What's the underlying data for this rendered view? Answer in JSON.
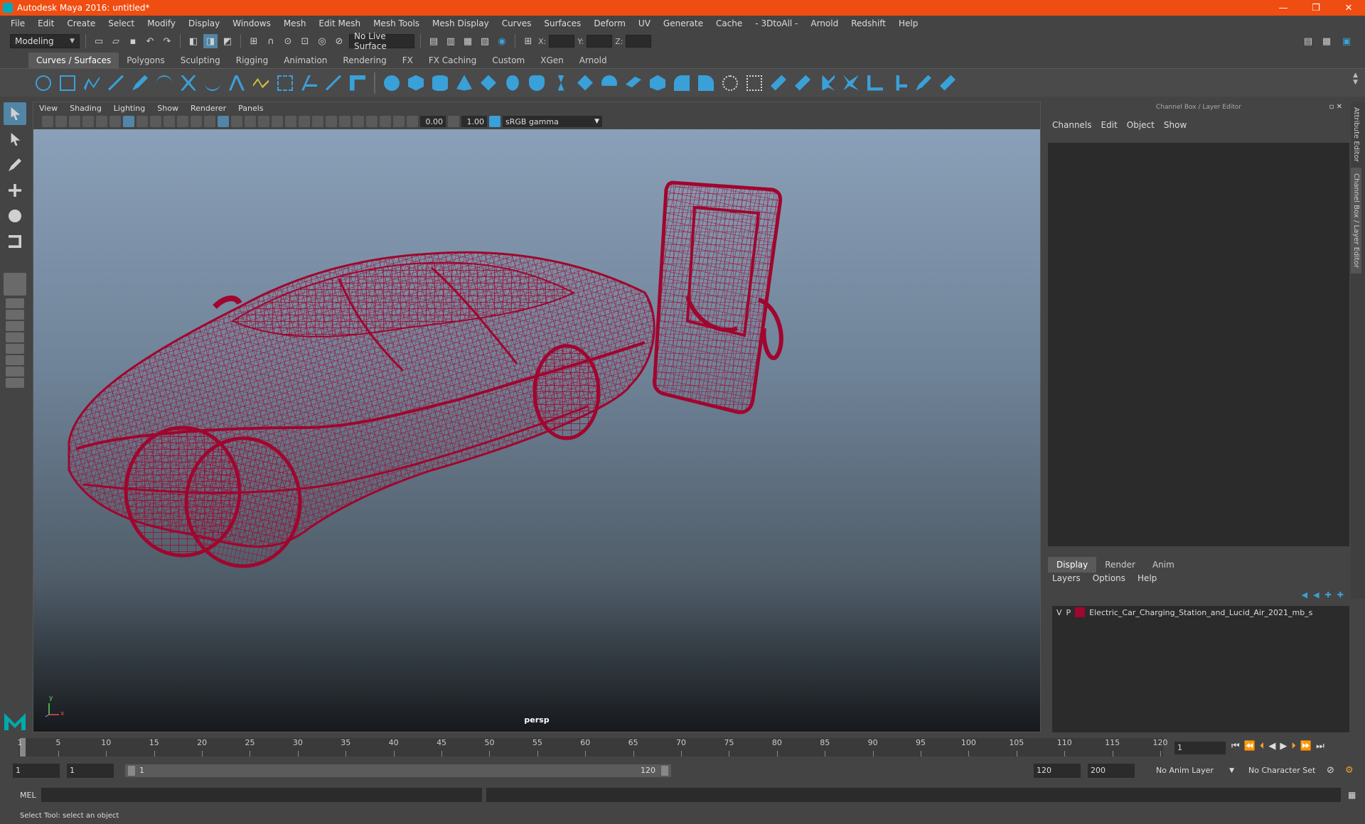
{
  "window": {
    "title": "Autodesk Maya 2016: untitled*",
    "min": "—",
    "max": "❐",
    "close": "✕"
  },
  "menubar": [
    "File",
    "Edit",
    "Create",
    "Select",
    "Modify",
    "Display",
    "Windows",
    "Mesh",
    "Edit Mesh",
    "Mesh Tools",
    "Mesh Display",
    "Curves",
    "Surfaces",
    "Deform",
    "UV",
    "Generate",
    "Cache",
    "- 3DtoAll -",
    "Arnold",
    "Redshift",
    "Help"
  ],
  "statusline": {
    "mode": "Modeling",
    "live_surface": "No Live Surface",
    "x_label": "X:",
    "y_label": "Y:",
    "z_label": "Z:"
  },
  "shelf_tabs": [
    "Curves / Surfaces",
    "Polygons",
    "Sculpting",
    "Rigging",
    "Animation",
    "Rendering",
    "FX",
    "FX Caching",
    "Custom",
    "XGen",
    "Arnold"
  ],
  "panel": {
    "menu": [
      "View",
      "Shading",
      "Lighting",
      "Show",
      "Renderer",
      "Panels"
    ],
    "exposure": "0.00",
    "gamma": "1.00",
    "colorspace": "sRGB gamma",
    "camera": "persp",
    "axis_y": "y",
    "axis_x": "x"
  },
  "channel_box": {
    "header": "Channel Box / Layer Editor",
    "menu": [
      "Channels",
      "Edit",
      "Object",
      "Show"
    ]
  },
  "layer_editor": {
    "tabs": [
      "Display",
      "Render",
      "Anim"
    ],
    "menu": [
      "Layers",
      "Options",
      "Help"
    ],
    "layer": {
      "v": "V",
      "p": "P",
      "name": "Electric_Car_Charging_Station_and_Lucid_Air_2021_mb_s",
      "color": "#a0062e"
    }
  },
  "side_tabs": [
    "Attribute Editor",
    "Channel Box / Layer Editor"
  ],
  "timeslider": {
    "ticks": [
      "1",
      "5",
      "10",
      "15",
      "20",
      "25",
      "30",
      "35",
      "40",
      "45",
      "50",
      "55",
      "60",
      "65",
      "70",
      "75",
      "80",
      "85",
      "90",
      "95",
      "100",
      "105",
      "110",
      "115",
      "120"
    ],
    "current_frame": "1"
  },
  "range": {
    "start": "1",
    "playback_start": "1",
    "bar_start": "1",
    "bar_end": "120",
    "playback_end": "120",
    "end": "200",
    "anim_layer": "No Anim Layer",
    "char_set": "No Character Set"
  },
  "cmdline": {
    "label": "MEL"
  },
  "helpline": "Select Tool: select an object",
  "colors": {
    "wire": "#a0062e",
    "accent": "#3aa0d8",
    "titlebar": "#f04d12"
  }
}
